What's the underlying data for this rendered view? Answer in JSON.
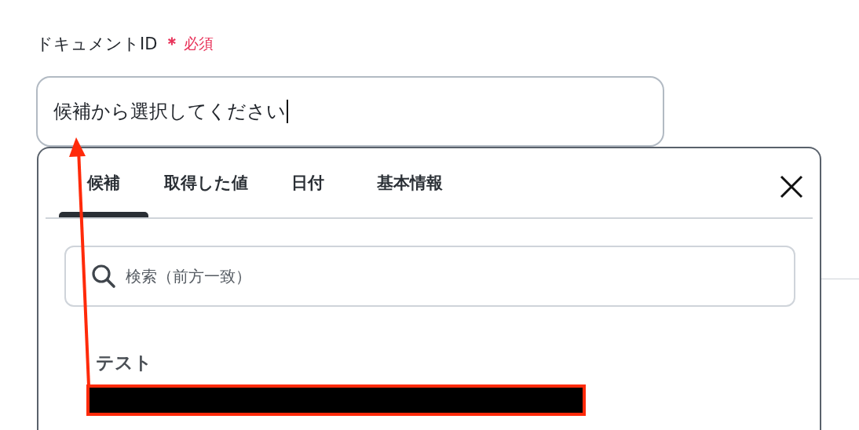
{
  "field": {
    "label": "ドキュメントID",
    "required_mark": "＊",
    "required_text": "必須",
    "value": "候補から選択してください",
    "focused": true
  },
  "popup": {
    "tabs": [
      {
        "label": "候補",
        "selected": true
      },
      {
        "label": "取得した値",
        "selected": false
      },
      {
        "label": "日付",
        "selected": false
      },
      {
        "label": "基本情報",
        "selected": false
      }
    ],
    "search": {
      "placeholder": "検索（前方一致）"
    },
    "groups": [
      {
        "heading": "テスト"
      }
    ]
  }
}
